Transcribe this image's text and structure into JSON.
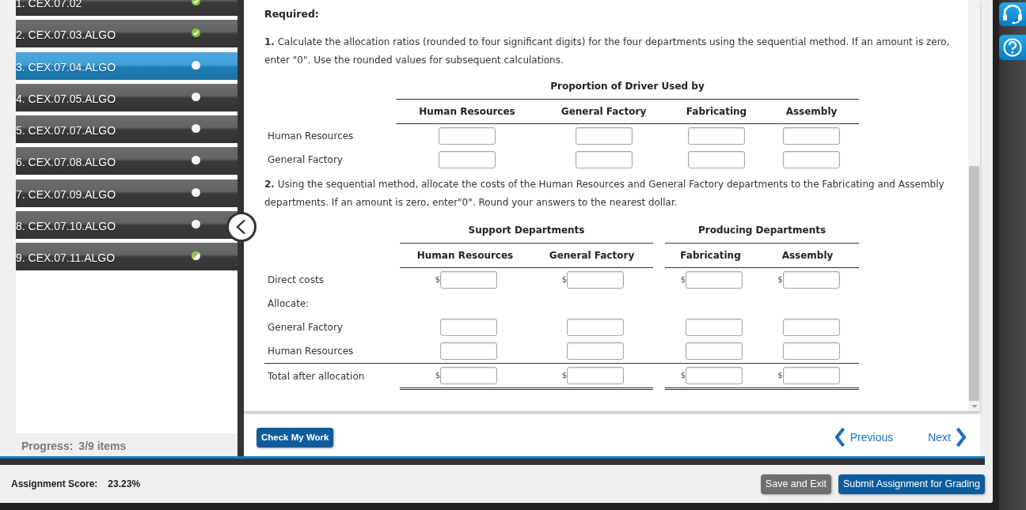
{
  "sidebar": {
    "items": [
      {
        "label": "1. CEX.07.02",
        "kind": "complete",
        "selected": false
      },
      {
        "label": "2. CEX.07.03.ALGO",
        "kind": "complete",
        "selected": false
      },
      {
        "label": "3. CEX.07.04.ALGO",
        "kind": "empty",
        "selected": true
      },
      {
        "label": "4. CEX.07.05.ALGO",
        "kind": "empty",
        "selected": false
      },
      {
        "label": "5. CEX.07.07.ALGO",
        "kind": "empty",
        "selected": false
      },
      {
        "label": "6. CEX.07.08.ALGO",
        "kind": "empty",
        "selected": false
      },
      {
        "label": "7. CEX.07.09.ALGO",
        "kind": "empty",
        "selected": false
      },
      {
        "label": "8. CEX.07.10.ALGO",
        "kind": "empty",
        "selected": false
      },
      {
        "label": "9. CEX.07.11.ALGO",
        "kind": "partial",
        "selected": false
      }
    ],
    "progress_label": "Progress:",
    "progress_value": "3/9 items"
  },
  "question": {
    "heading": "Required:",
    "part_1": {
      "text": "**1.** Calculate the allocation ratios (rounded to four significant digits) for the four departments using the sequential method. If an amount is zero, enter \"0\". Use the rounded values for subsequent calculations.",
      "table": {
        "caption": "Proportion of Driver Used by",
        "columns": [
          "Human Resources",
          "General Factory",
          "Fabricating",
          "Assembly"
        ],
        "rows": [
          {
            "label": "Human Resources",
            "cells": [
              {
                "kind": "field"
              },
              {
                "kind": "field"
              },
              {
                "kind": "field"
              },
              {
                "kind": "field"
              }
            ]
          },
          {
            "label": "General Factory",
            "cells": [
              {
                "kind": "field"
              },
              {
                "kind": "field"
              },
              {
                "kind": "field"
              },
              {
                "kind": "field"
              }
            ]
          }
        ]
      }
    },
    "part_2": {
      "text": "**2.** Using the sequential method, allocate the costs of the Human Resources and General Factory departments to the Fabricating and Assembly departments. If an amount is zero, enter\"0\". Round your answers to the nearest dollar.",
      "table": {
        "groups": [
          {
            "label": "Support Departments",
            "columns": [
              "Human Resources",
              "General Factory"
            ]
          },
          {
            "label": "Producing Departments",
            "columns": [
              "Fabricating",
              "Assembly"
            ]
          }
        ],
        "rows": [
          {
            "kind": "amount",
            "label": "Direct costs",
            "cells": [
              {
                "kind": "field",
                "prefix": "$"
              },
              {
                "kind": "field",
                "prefix": "$"
              },
              {
                "kind": "field",
                "prefix": "$"
              },
              {
                "kind": "field",
                "prefix": "$"
              }
            ]
          },
          {
            "kind": "group",
            "label": "Allocate:",
            "children": [
              {
                "kind": "amount",
                "label": "General Factory",
                "cells": [
                  {
                    "kind": "field"
                  },
                  {
                    "kind": "field"
                  },
                  {
                    "kind": "field"
                  },
                  {
                    "kind": "field"
                  }
                ]
              },
              {
                "kind": "amount",
                "label": "Human Resources",
                "cells": [
                  {
                    "kind": "field"
                  },
                  {
                    "kind": "field"
                  },
                  {
                    "kind": "field"
                  },
                  {
                    "kind": "field"
                  }
                ]
              }
            ]
          },
          {
            "kind": "total",
            "label": "Total after allocation",
            "cells": [
              {
                "kind": "field",
                "prefix": "$"
              },
              {
                "kind": "field",
                "prefix": "$"
              },
              {
                "kind": "field",
                "prefix": "$"
              },
              {
                "kind": "field",
                "prefix": "$"
              }
            ]
          }
        ]
      }
    }
  },
  "actions": {
    "check": "Check My Work",
    "previous": "Previous",
    "next": "Next"
  },
  "footer": {
    "score_label": "Assignment Score:",
    "score": "23.23%",
    "buttons": [
      {
        "label": "Save and Exit",
        "kind": "secondary"
      },
      {
        "label": "Submit Assignment for Grading",
        "kind": "primary"
      }
    ]
  }
}
